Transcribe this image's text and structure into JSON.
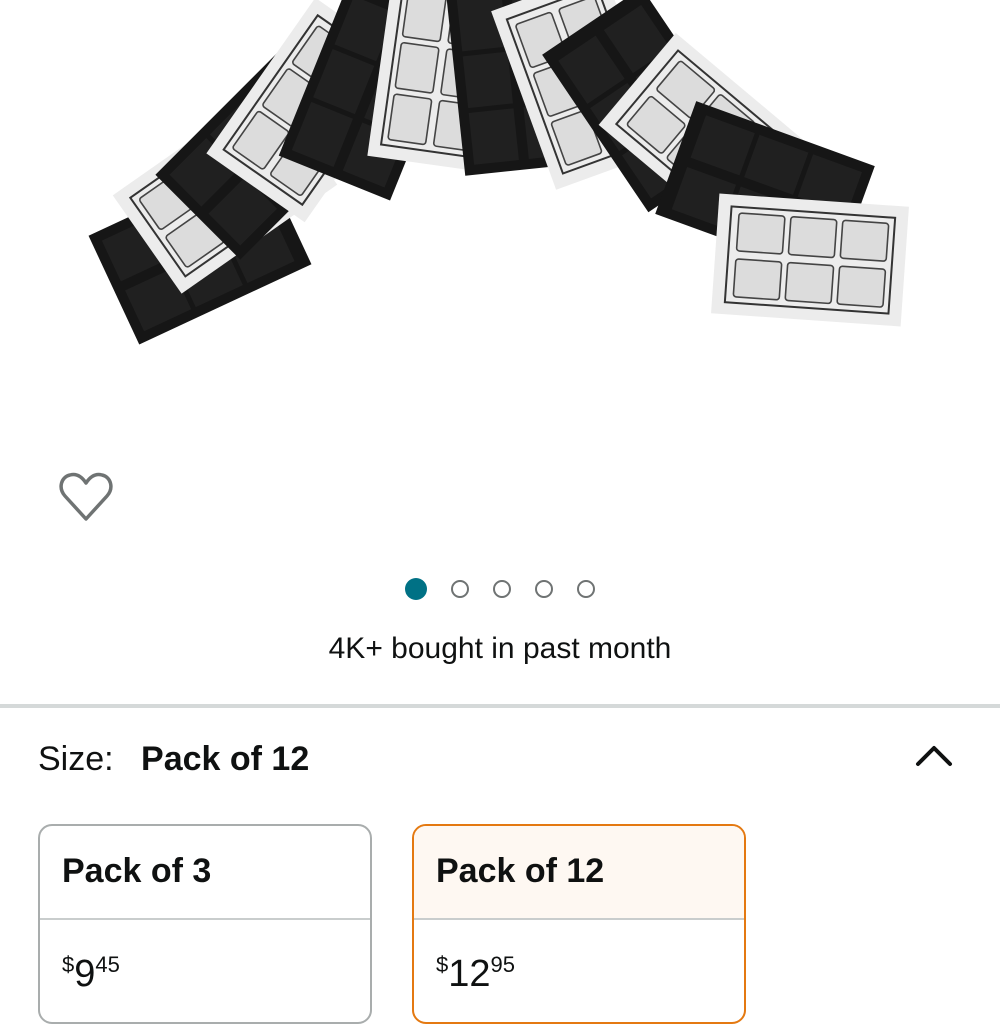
{
  "bought_text": "4K+ bought in past month",
  "carousel": {
    "total": 5,
    "active_index": 0
  },
  "size": {
    "label": "Size:",
    "value": "Pack of 12"
  },
  "options": [
    {
      "title": "Pack of 3",
      "price_symbol": "$",
      "price_whole": "9",
      "price_cents": "45",
      "selected": false
    },
    {
      "title": "Pack of 12",
      "price_symbol": "$",
      "price_whole": "12",
      "price_cents": "95",
      "selected": true
    }
  ],
  "colors": {
    "accent": "#007185",
    "selected_border": "#e47911",
    "divider": "#d5d9d9"
  }
}
